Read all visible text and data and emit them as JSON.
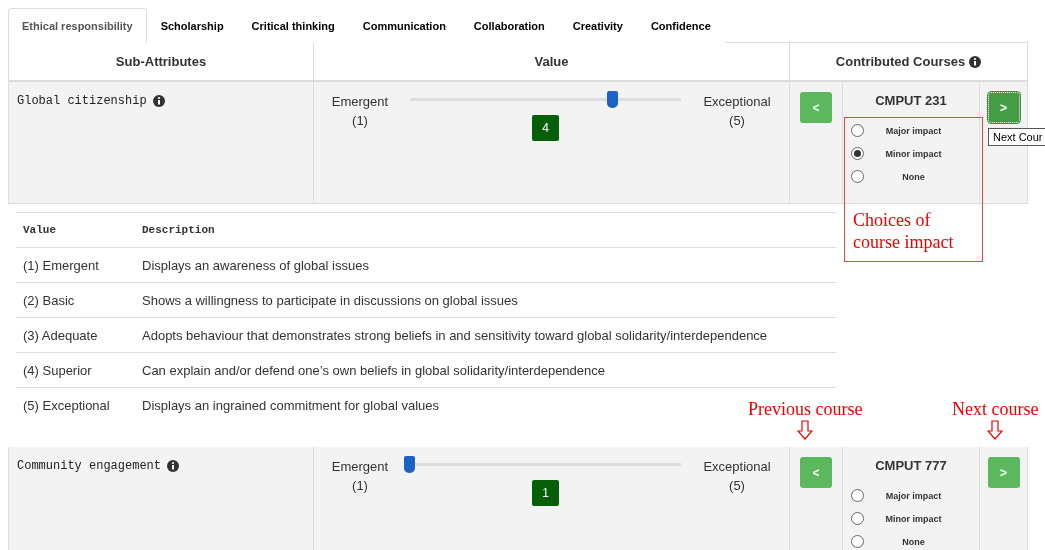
{
  "tabs": [
    {
      "label": "Ethical responsibility",
      "selected": true
    },
    {
      "label": "Scholarship",
      "selected": false
    },
    {
      "label": "Critical thinking",
      "selected": false
    },
    {
      "label": "Communication",
      "selected": false
    },
    {
      "label": "Collaboration",
      "selected": false
    },
    {
      "label": "Creativity",
      "selected": false
    },
    {
      "label": "Confidence",
      "selected": false
    }
  ],
  "columns": [
    "Sub-Attributes",
    "Value",
    "Contributed Courses"
  ],
  "attributes": [
    {
      "name": "Global citizenship",
      "min_label": "Emergent",
      "min_value": "(1)",
      "max_label": "Exceptional",
      "max_value": "(5)",
      "level": 0.75,
      "value": "4",
      "course": {
        "prev": "<",
        "next": ">",
        "next_focused": true,
        "name": "CMPUT 231",
        "options": [
          {
            "label": "Major impact",
            "selected": false
          },
          {
            "label": "Minor impact",
            "selected": true
          },
          {
            "label": "None",
            "selected": false
          }
        ]
      },
      "descriptions": {
        "columns": [
          "Value",
          "Description"
        ],
        "rows": [
          {
            "value": "(1) Emergent",
            "description": "Displays an awareness of global issues"
          },
          {
            "value": "(2) Basic",
            "description": "Shows a willingness to participate in discussions on global issues"
          },
          {
            "value": "(3) Adequate",
            "description": "Adopts behaviour that demonstrates strong beliefs in and sensitivity toward global solidarity/interdependence"
          },
          {
            "value": "(4) Superior",
            "description": "Can explain and/or defend one’s own beliefs in global solidarity/interdependence"
          },
          {
            "value": "(5) Exceptional",
            "description": "Displays an ingrained commitment for global values"
          }
        ]
      }
    },
    {
      "name": "Community engagement",
      "min_label": "Emergent",
      "min_value": "(1)",
      "max_label": "Exceptional",
      "max_value": "(5)",
      "level": 0,
      "value": "1",
      "course": {
        "prev": "<",
        "next": ">",
        "next_focused": false,
        "name": "CMPUT 777",
        "options": [
          {
            "label": "Major impact",
            "selected": false
          },
          {
            "label": "Minor impact",
            "selected": false
          },
          {
            "label": "None",
            "selected": false
          }
        ]
      }
    }
  ],
  "tooltip": "Next Cour",
  "annotations": [
    {
      "kind": "box",
      "text": "Choices of course impact"
    },
    {
      "kind": "arrow",
      "text": "Previous course"
    },
    {
      "kind": "arrow",
      "text": "Next course"
    }
  ]
}
